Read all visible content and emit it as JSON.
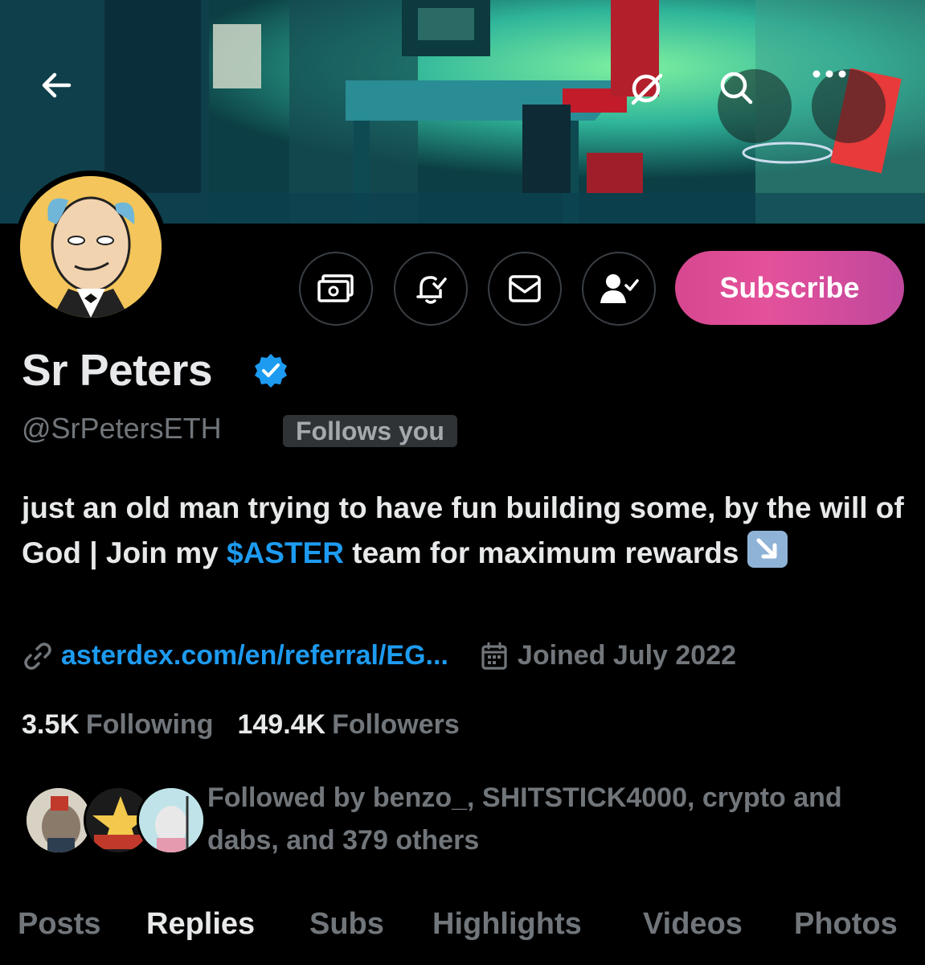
{
  "header": {
    "back_icon": "arrow-left-icon",
    "grok_icon": "grok-icon",
    "search_icon": "search-icon",
    "more_icon": "more-horizontal-icon"
  },
  "profile": {
    "display_name": "Sr Peters",
    "verified": true,
    "handle": "@SrPetersETH",
    "follows_you_label": "Follows you",
    "bio_part1": "just an old man trying to have fun building some, by the will of God | Join my ",
    "bio_cashtag": "$ASTER",
    "bio_part2": " team for maximum rewards ",
    "bio_emoji": "↘️",
    "link": "asterdex.com/en/referral/EG...",
    "joined": "Joined July 2022",
    "following_count": "3.5K",
    "following_label": "Following",
    "followers_count": "149.4K",
    "followers_label": "Followers",
    "followed_by_text": "Followed by benzo_, SHITSTICK4000, crypto and dabs, and 379 others"
  },
  "actions": {
    "subscribe_label": "Subscribe",
    "tip_icon": "money-icon",
    "notify_icon": "bell-check-icon",
    "dm_icon": "envelope-icon",
    "follow_icon": "person-check-icon"
  },
  "tabs": [
    "Posts",
    "Replies",
    "Subs",
    "Highlights",
    "Videos",
    "Photos"
  ],
  "active_tab": "Replies",
  "colors": {
    "background": "#000000",
    "accent": "#1d9bf0",
    "muted": "#71767b",
    "subscribe_gradient_start": "#d6478f",
    "subscribe_gradient_end": "#c0479d"
  }
}
